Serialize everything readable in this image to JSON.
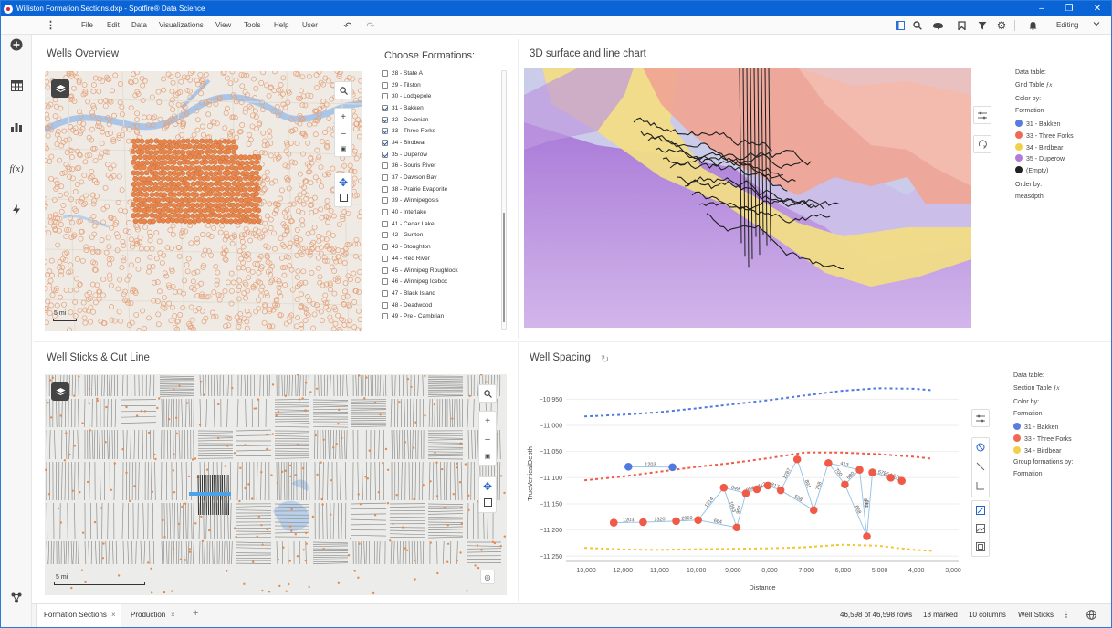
{
  "window": {
    "title": "Williston Formation Sections.dxp - Spotfire® Data Science"
  },
  "menu": {
    "items": [
      "File",
      "Edit",
      "Data",
      "Visualizations",
      "View",
      "Tools",
      "Help",
      "User"
    ],
    "mode": "Editing"
  },
  "wells_overview": {
    "title": "Wells Overview",
    "scale": "5 mi"
  },
  "formations": {
    "title": "Choose Formations:",
    "items": [
      {
        "label": "28 - State A",
        "checked": false
      },
      {
        "label": "29 - Tilston",
        "checked": false
      },
      {
        "label": "30 - Lodgepole",
        "checked": false
      },
      {
        "label": "31 - Bakken",
        "checked": true
      },
      {
        "label": "32 - Devonian",
        "checked": true
      },
      {
        "label": "33 - Three Forks",
        "checked": true
      },
      {
        "label": "34 - Birdbear",
        "checked": true
      },
      {
        "label": "35 - Duperow",
        "checked": true
      },
      {
        "label": "36 - Souris River",
        "checked": false
      },
      {
        "label": "37 - Dawson Bay",
        "checked": false
      },
      {
        "label": "38 - Prairie Evaporite",
        "checked": false
      },
      {
        "label": "39 - Winnipegosis",
        "checked": false
      },
      {
        "label": "40 - Interlake",
        "checked": false
      },
      {
        "label": "41 - Cedar Lake",
        "checked": false
      },
      {
        "label": "42 - Gunton",
        "checked": false
      },
      {
        "label": "43 - Stoughton",
        "checked": false
      },
      {
        "label": "44 - Red River",
        "checked": false
      },
      {
        "label": "45 - Winnipeg Roughlock",
        "checked": false
      },
      {
        "label": "46 - Winnipeg Icebox",
        "checked": false
      },
      {
        "label": "47 - Black Island",
        "checked": false
      },
      {
        "label": "48 - Deadwood",
        "checked": false
      },
      {
        "label": "49 - Pre - Cambrian",
        "checked": false
      }
    ]
  },
  "surface3d": {
    "title": "3D surface and line chart",
    "data_table_label": "Data table:",
    "data_table": "Grid Table",
    "color_by_label": "Color by:",
    "color_by": "Formation",
    "legend": [
      {
        "label": "31 - Bakken",
        "color": "#5b7be0"
      },
      {
        "label": "33 - Three Forks",
        "color": "#ef6a55"
      },
      {
        "label": "34 - Birdbear",
        "color": "#f3d04a"
      },
      {
        "label": "35 - Duperow",
        "color": "#b57ad9"
      },
      {
        "label": "(Empty)",
        "color": "#222222"
      }
    ],
    "order_by_label": "Order by:",
    "order_by": "measdpth"
  },
  "well_sticks": {
    "title": "Well Sticks & Cut Line",
    "scale": "5 mi"
  },
  "well_spacing": {
    "title": "Well Spacing",
    "data_table_label": "Data table:",
    "data_table": "Section Table",
    "color_by_label": "Color by:",
    "color_by": "Formation",
    "legend": [
      {
        "label": "31 - Bakken",
        "color": "#5b7be0"
      },
      {
        "label": "33 - Three Forks",
        "color": "#ef6a55"
      },
      {
        "label": "34 - Birdbear",
        "color": "#f3d04a"
      }
    ],
    "group_label": "Group formations by:",
    "group_by": "Formation"
  },
  "chart_data": {
    "type": "scatter",
    "title": "Well Spacing",
    "xlabel": "Distance",
    "ylabel": "TrueVerticalDepth",
    "xlim": [
      -13500,
      -2800
    ],
    "ylim": [
      -11260,
      -10925
    ],
    "xticks": [
      -13000,
      -12000,
      -11000,
      -10000,
      -9000,
      -8000,
      -7000,
      -6000,
      -5000,
      -4000,
      -3000
    ],
    "yticks": [
      -10950,
      -11000,
      -11050,
      -11100,
      -11150,
      -11200,
      -11250
    ],
    "tick_labels_x": [
      "−13,000",
      "−12,000",
      "−11,000",
      "−10,000",
      "−9,000",
      "−8,000",
      "−7,000",
      "−6,000",
      "−5,000",
      "−4,000",
      "−3,000"
    ],
    "tick_labels_y": [
      "−10,950",
      "−11,000",
      "−11,050",
      "−11,100",
      "−11,150",
      "−11,200",
      "−11,250"
    ],
    "series": [
      {
        "name": "31 - Bakken",
        "color": "#4f7ae0",
        "line": [
          [
            -13000,
            -10983
          ],
          [
            -12000,
            -10980
          ],
          [
            -11000,
            -10975
          ],
          [
            -10000,
            -10968
          ],
          [
            -9000,
            -10960
          ],
          [
            -8000,
            -10952
          ],
          [
            -7000,
            -10943
          ],
          [
            -6000,
            -10934
          ],
          [
            -5000,
            -10929
          ],
          [
            -4000,
            -10930
          ],
          [
            -3500,
            -10933
          ]
        ],
        "points": [
          [
            -10600,
            -11080
          ],
          [
            -11800,
            -11079
          ]
        ]
      },
      {
        "name": "33 - Three Forks",
        "color": "#ef5b47",
        "line": [
          [
            -13000,
            -11105
          ],
          [
            -12000,
            -11098
          ],
          [
            -11000,
            -11089
          ],
          [
            -10000,
            -11080
          ],
          [
            -9000,
            -11072
          ],
          [
            -8000,
            -11063
          ],
          [
            -7000,
            -11052
          ],
          [
            -6000,
            -11052
          ],
          [
            -5000,
            -11055
          ],
          [
            -4000,
            -11060
          ],
          [
            -3500,
            -11064
          ]
        ],
        "points": [
          [
            -12200,
            -11186
          ],
          [
            -11400,
            -11185
          ],
          [
            -10500,
            -11183
          ],
          [
            -9900,
            -11181
          ],
          [
            -9200,
            -11119
          ],
          [
            -8850,
            -11195
          ],
          [
            -8600,
            -11130
          ],
          [
            -8300,
            -11122
          ],
          [
            -8000,
            -11115
          ],
          [
            -7650,
            -11124
          ],
          [
            -7200,
            -11065
          ],
          [
            -6750,
            -11162
          ],
          [
            -6350,
            -11072
          ],
          [
            -5900,
            -11113
          ],
          [
            -5500,
            -11085
          ],
          [
            -5300,
            -11212
          ],
          [
            -5150,
            -11090
          ],
          [
            -4650,
            -11100
          ],
          [
            -4350,
            -11106
          ]
        ]
      },
      {
        "name": "34 - Birdbear",
        "color": "#f2c631",
        "line": [
          [
            -13000,
            -11234
          ],
          [
            -12000,
            -11237
          ],
          [
            -11000,
            -11238
          ],
          [
            -10000,
            -11237
          ],
          [
            -9000,
            -11236
          ],
          [
            -8000,
            -11235
          ],
          [
            -7000,
            -11233
          ],
          [
            -6000,
            -11228
          ],
          [
            -5000,
            -11230
          ],
          [
            -4000,
            -11238
          ],
          [
            -3500,
            -11240
          ]
        ],
        "points": []
      }
    ],
    "edge_labels": [
      "1203",
      "1320",
      "2069",
      "1314",
      "1663",
      "957",
      "956",
      "412",
      "817",
      "1287",
      "891",
      "758",
      "700",
      "680",
      "879",
      "449",
      "672",
      "676",
      "649",
      "558",
      "668",
      "954",
      "684",
      "413"
    ]
  },
  "bottom": {
    "tabs": [
      "Formation Sections",
      "Production"
    ],
    "rows": "46,598 of 46,598 rows",
    "marked": "18 marked",
    "columns": "10 columns",
    "table": "Well Sticks"
  }
}
